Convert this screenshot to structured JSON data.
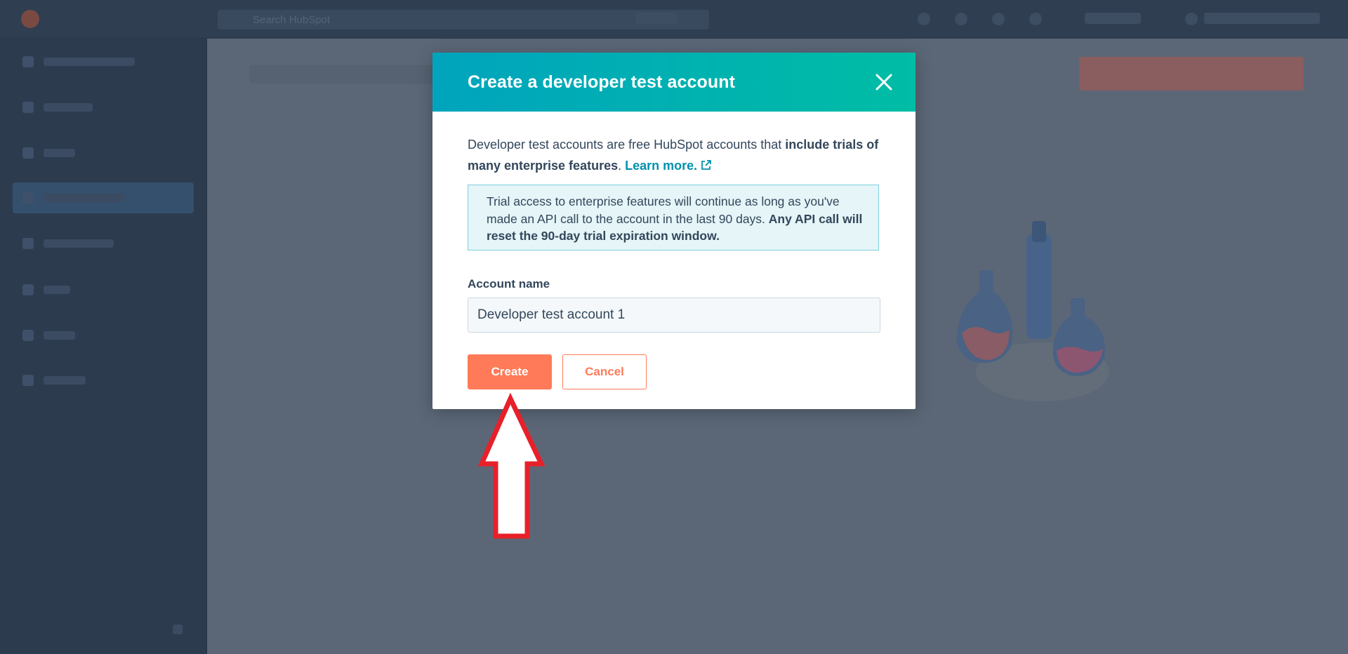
{
  "background": {
    "topbar": {
      "search_label": "Search HubSpot"
    },
    "sidebar": {
      "items": [
        "",
        "",
        "",
        "",
        "",
        "",
        "",
        ""
      ],
      "active_index": 3
    }
  },
  "modal": {
    "title": "Create a developer test account",
    "intro": {
      "text_plain": "Developer test accounts are free HubSpot accounts that ",
      "text_bold": "include trials of many enterprise features",
      "text_after": ". ",
      "link": "Learn more."
    },
    "alert": {
      "text_plain": "Trial access to enterprise features will continue as long as you've made an API call to the account in the last 90 days. ",
      "text_bold": "Any API call will reset the 90-day trial expiration window."
    },
    "field": {
      "label": "Account name",
      "value": "Developer test account 1"
    },
    "buttons": {
      "create": "Create",
      "cancel": "Cancel"
    }
  },
  "icons": {
    "close": "close-icon",
    "external_link": "external-link-icon",
    "annotation_arrow": "up-arrow-annotation"
  },
  "colors": {
    "header_gradient_start": "#00a4bd",
    "header_gradient_end": "#00bda5",
    "primary_button": "#ff7a59",
    "link": "#0091ae",
    "alert_bg": "#e5f5f8",
    "alert_border": "#7fd1de",
    "text": "#33475b",
    "annotation_arrow": "#e8202a"
  }
}
